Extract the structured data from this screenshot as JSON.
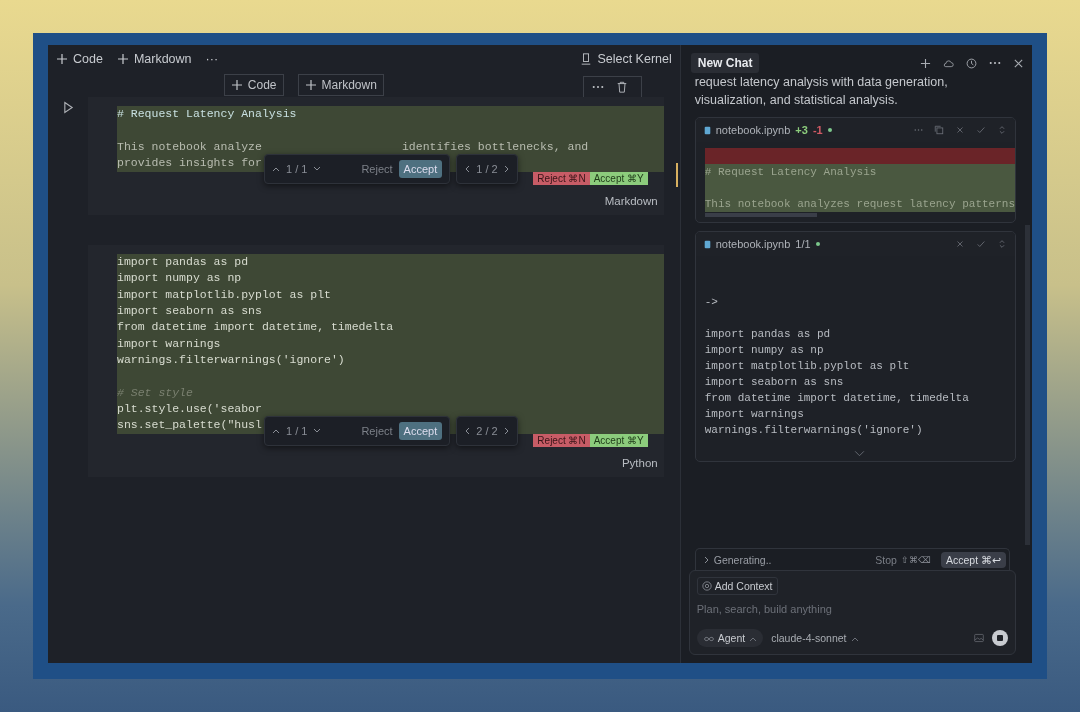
{
  "toolbar": {
    "add_code": "Code",
    "add_markdown": "Markdown",
    "more": "···",
    "kernel": "Select Kernel"
  },
  "insert_bar": {
    "add_code": "Code",
    "add_markdown": "Markdown"
  },
  "cells": [
    {
      "language": "Markdown",
      "run_button": true,
      "lines": [
        {
          "kind": "heading",
          "parts": [
            "# Request Latency Analysis"
          ]
        },
        {
          "kind": "blank"
        },
        {
          "kind": "text",
          "parts": [
            "This notebook analyze",
            "identifies bottlenecks, and"
          ]
        },
        {
          "kind": "text",
          "parts": [
            "provides insights for"
          ]
        }
      ],
      "popup": {
        "counter": "1 / 1",
        "reject": "Reject",
        "accept": "Accept",
        "position": "1 / 2"
      },
      "reject_badge": "Reject ⌘N",
      "accept_badge": "Accept ⌘Y"
    },
    {
      "language": "Python",
      "run_button": false,
      "lines": [
        {
          "kind": "code",
          "parts": [
            "import pandas as pd"
          ]
        },
        {
          "kind": "code",
          "parts": [
            "import numpy as np"
          ]
        },
        {
          "kind": "code",
          "parts": [
            "import matplotlib.pyplot as plt"
          ]
        },
        {
          "kind": "code",
          "parts": [
            "import seaborn as sns"
          ]
        },
        {
          "kind": "code",
          "parts": [
            "from datetime import datetime, timedelta"
          ]
        },
        {
          "kind": "code",
          "parts": [
            "import warnings"
          ]
        },
        {
          "kind": "code",
          "parts": [
            "warnings.filterwarnings('ignore')"
          ]
        },
        {
          "kind": "blank"
        },
        {
          "kind": "comment",
          "parts": [
            "# Set style"
          ]
        },
        {
          "kind": "code",
          "parts": [
            "plt.style.use('seabor"
          ]
        },
        {
          "kind": "code",
          "parts": [
            "sns.set_palette(\"husl"
          ]
        }
      ],
      "popup": {
        "counter": "1 / 1",
        "reject": "Reject",
        "accept": "Accept",
        "position": "2 / 2"
      },
      "reject_badge": "Reject ⌘N",
      "accept_badge": "Accept ⌘Y"
    }
  ],
  "chat": {
    "tab": "New Chat",
    "message": "request latency analysis with data generation, visualization, and statistical analysis.",
    "cards": [
      {
        "file": "notebook.ipynb",
        "added": "+3",
        "removed": "-1",
        "lines": [
          {
            "kind": "removed"
          },
          {
            "kind": "added",
            "text": "# Request Latency Analysis"
          },
          {
            "kind": "added"
          },
          {
            "kind": "added",
            "text": "This notebook analyzes request latency patterns"
          }
        ]
      },
      {
        "file": "notebook.ipynb",
        "count": "1/1",
        "lines": [
          {
            "kind": "plain"
          },
          {
            "kind": "plain"
          },
          {
            "kind": "plain",
            "text": "->"
          },
          {
            "kind": "plain"
          },
          {
            "kind": "plain",
            "text": "import pandas as pd"
          },
          {
            "kind": "plain",
            "text": "import numpy as np"
          },
          {
            "kind": "plain",
            "text": "import matplotlib.pyplot as plt"
          },
          {
            "kind": "plain",
            "text": "import seaborn as sns"
          },
          {
            "kind": "plain",
            "text": "from datetime import datetime, timedelta"
          },
          {
            "kind": "plain",
            "text": "import warnings"
          },
          {
            "kind": "plain",
            "text": "warnings.filterwarnings('ignore')"
          }
        ]
      }
    ],
    "status": {
      "label": "Generating..",
      "stop": "Stop",
      "stop_keys": "⇧⌘⌫",
      "accept": "Accept ⌘↩"
    },
    "composer": {
      "context": "Add Context",
      "placeholder": "Plan, search, build anything",
      "mode": "Agent",
      "model": "claude-4-sonnet"
    }
  }
}
